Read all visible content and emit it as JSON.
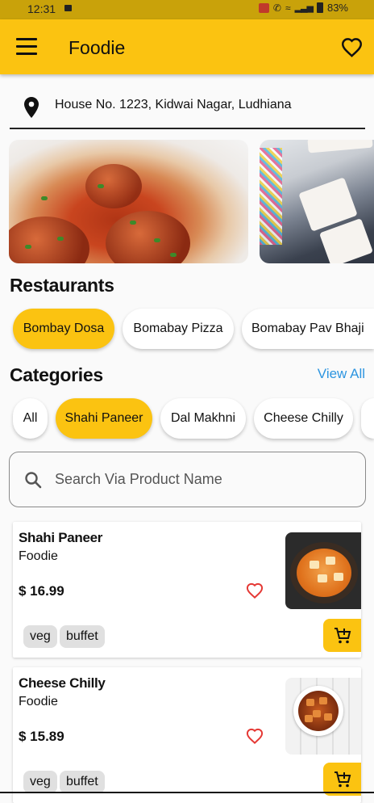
{
  "status_bar": {
    "time": "12:31",
    "battery": "83%"
  },
  "app_bar": {
    "title": "Foodie"
  },
  "location": {
    "address": "House No. 1223, Kidwai Nagar, Ludhiana"
  },
  "restaurants": {
    "title": "Restaurants",
    "items": [
      {
        "label": "Bombay Dosa",
        "active": true
      },
      {
        "label": "Bomabay Pizza",
        "active": false
      },
      {
        "label": "Bomabay Pav Bhaji",
        "active": false
      }
    ]
  },
  "categories": {
    "title": "Categories",
    "view_all": "View All",
    "items": [
      {
        "label": "All",
        "active": false
      },
      {
        "label": "Shahi Paneer",
        "active": true
      },
      {
        "label": "Dal Makhni",
        "active": false
      },
      {
        "label": "Cheese Chilly",
        "active": false
      }
    ]
  },
  "search": {
    "placeholder": "Search Via Product Name",
    "value": ""
  },
  "products": [
    {
      "name": "Shahi Paneer",
      "brand": "Foodie",
      "price": "$ 16.99",
      "tags": [
        "veg",
        "buffet"
      ]
    },
    {
      "name": "Cheese Chilly",
      "brand": "Foodie",
      "price": "$ 15.89",
      "tags": [
        "veg",
        "buffet"
      ]
    }
  ],
  "colors": {
    "accent": "#fbc311",
    "link": "#2d95e0",
    "heart": "#e53935",
    "status_bar": "#c9a20a"
  },
  "icons": [
    "menu-icon",
    "heart-icon",
    "location-pin-icon",
    "search-icon",
    "add-to-cart-icon"
  ]
}
